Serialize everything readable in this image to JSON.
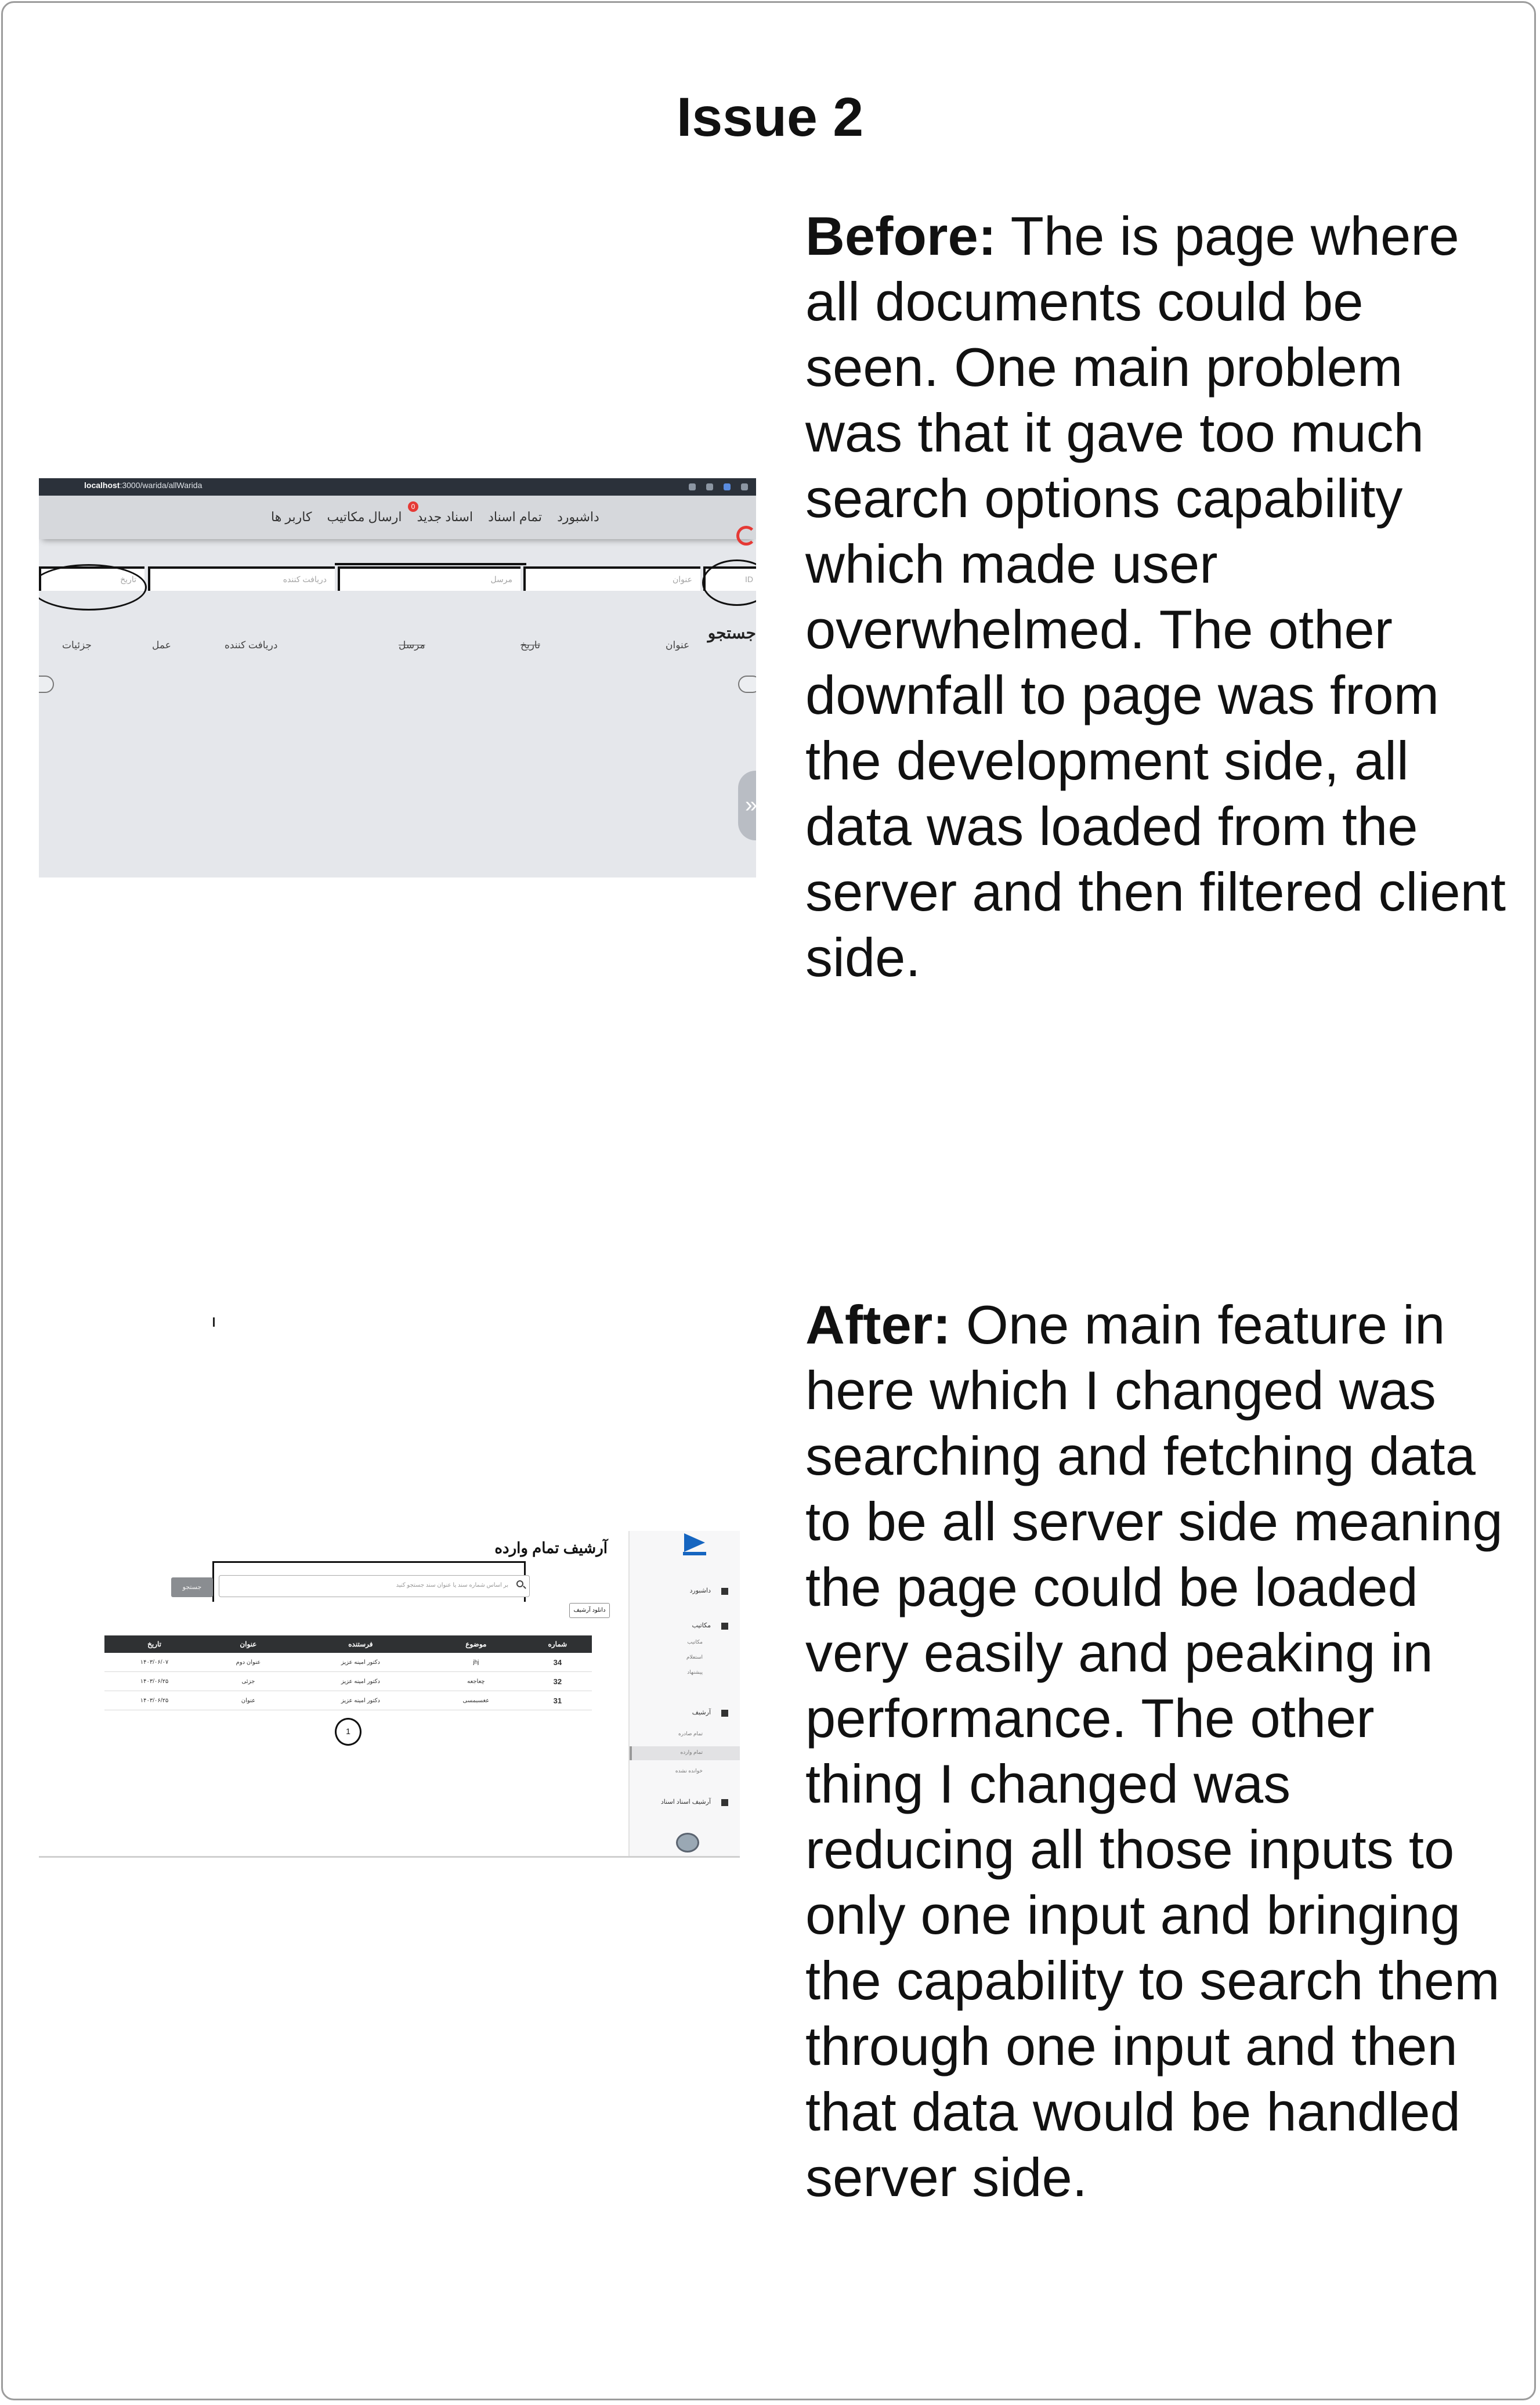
{
  "heading": "Issue 2",
  "before": {
    "label": "Before:",
    "text": " The is page where all documents could be seen. One main problem was that it gave too much search options capability which made user overwhelmed. The other downfall to page was from the development side, all data was loaded from the server and then filtered client side.",
    "screenshot": {
      "url_host": "localhost",
      "url_path": ":3000/warida/allWarida",
      "nav": [
        "داشبورد",
        "تمام اسناد",
        "اسناد جدید",
        "ارسال مکاتیب",
        "کاربر ها"
      ],
      "badge": "0",
      "inputs": [
        "ID",
        "عنوان",
        "مرسل",
        "دریافت کننده",
        "تاریخ"
      ],
      "columns": [
        "عنوان",
        "تاریخ",
        "مرسل",
        "دریافت کننده",
        "عمل",
        "جزئیات"
      ],
      "edge_text": "جستجو",
      "fab_glyph": "»"
    }
  },
  "after": {
    "label": "After:",
    "text": " One main feature in here which I changed was searching and fetching data to be all server side meaning the page could be loaded very easily and peaking in performance. The other thing I changed was reducing all those inputs to only one input and bringing the capability to search them through one input and then that data would be handled server side.",
    "screenshot": {
      "page_title": "آرشیف تمام وارده",
      "search_placeholder": "بر اساس شماره سند یا عنوان سند جستجو کنید",
      "search_button": "جستجو",
      "archive_button": "دانلود آرشیف",
      "sidebar": {
        "dashboard": "داشبورد",
        "messages": "مکاتیب",
        "sub1": "مکاتیب",
        "sub2": "استعلام",
        "sub3": "پیشنهاد",
        "archive": "آرشیف",
        "arch1": "تمام صادره",
        "arch2": "تمام وارده",
        "arch3": "خوانده نشده",
        "users_archive": "آرشیف اسناد اسناد"
      },
      "table": {
        "headers": [
          "شماره",
          "موضوع",
          "فرستنده",
          "عنوان",
          "تاریخ"
        ],
        "rows": [
          [
            "34",
            "jhj",
            "دکتور امینه عزیز",
            "عنوان دوم",
            "۱۴۰۳/۰۶/۰۷"
          ],
          [
            "32",
            "چعاجعه",
            "دکتور امینه عزیز",
            "جزئی",
            "۱۴۰۳/۰۶/۲۵"
          ],
          [
            "31",
            "عغسبمسی",
            "دکتور امینه عزیز",
            "عنوان",
            "۱۴۰۳/۰۶/۲۵"
          ]
        ]
      },
      "page_number": "1"
    }
  }
}
